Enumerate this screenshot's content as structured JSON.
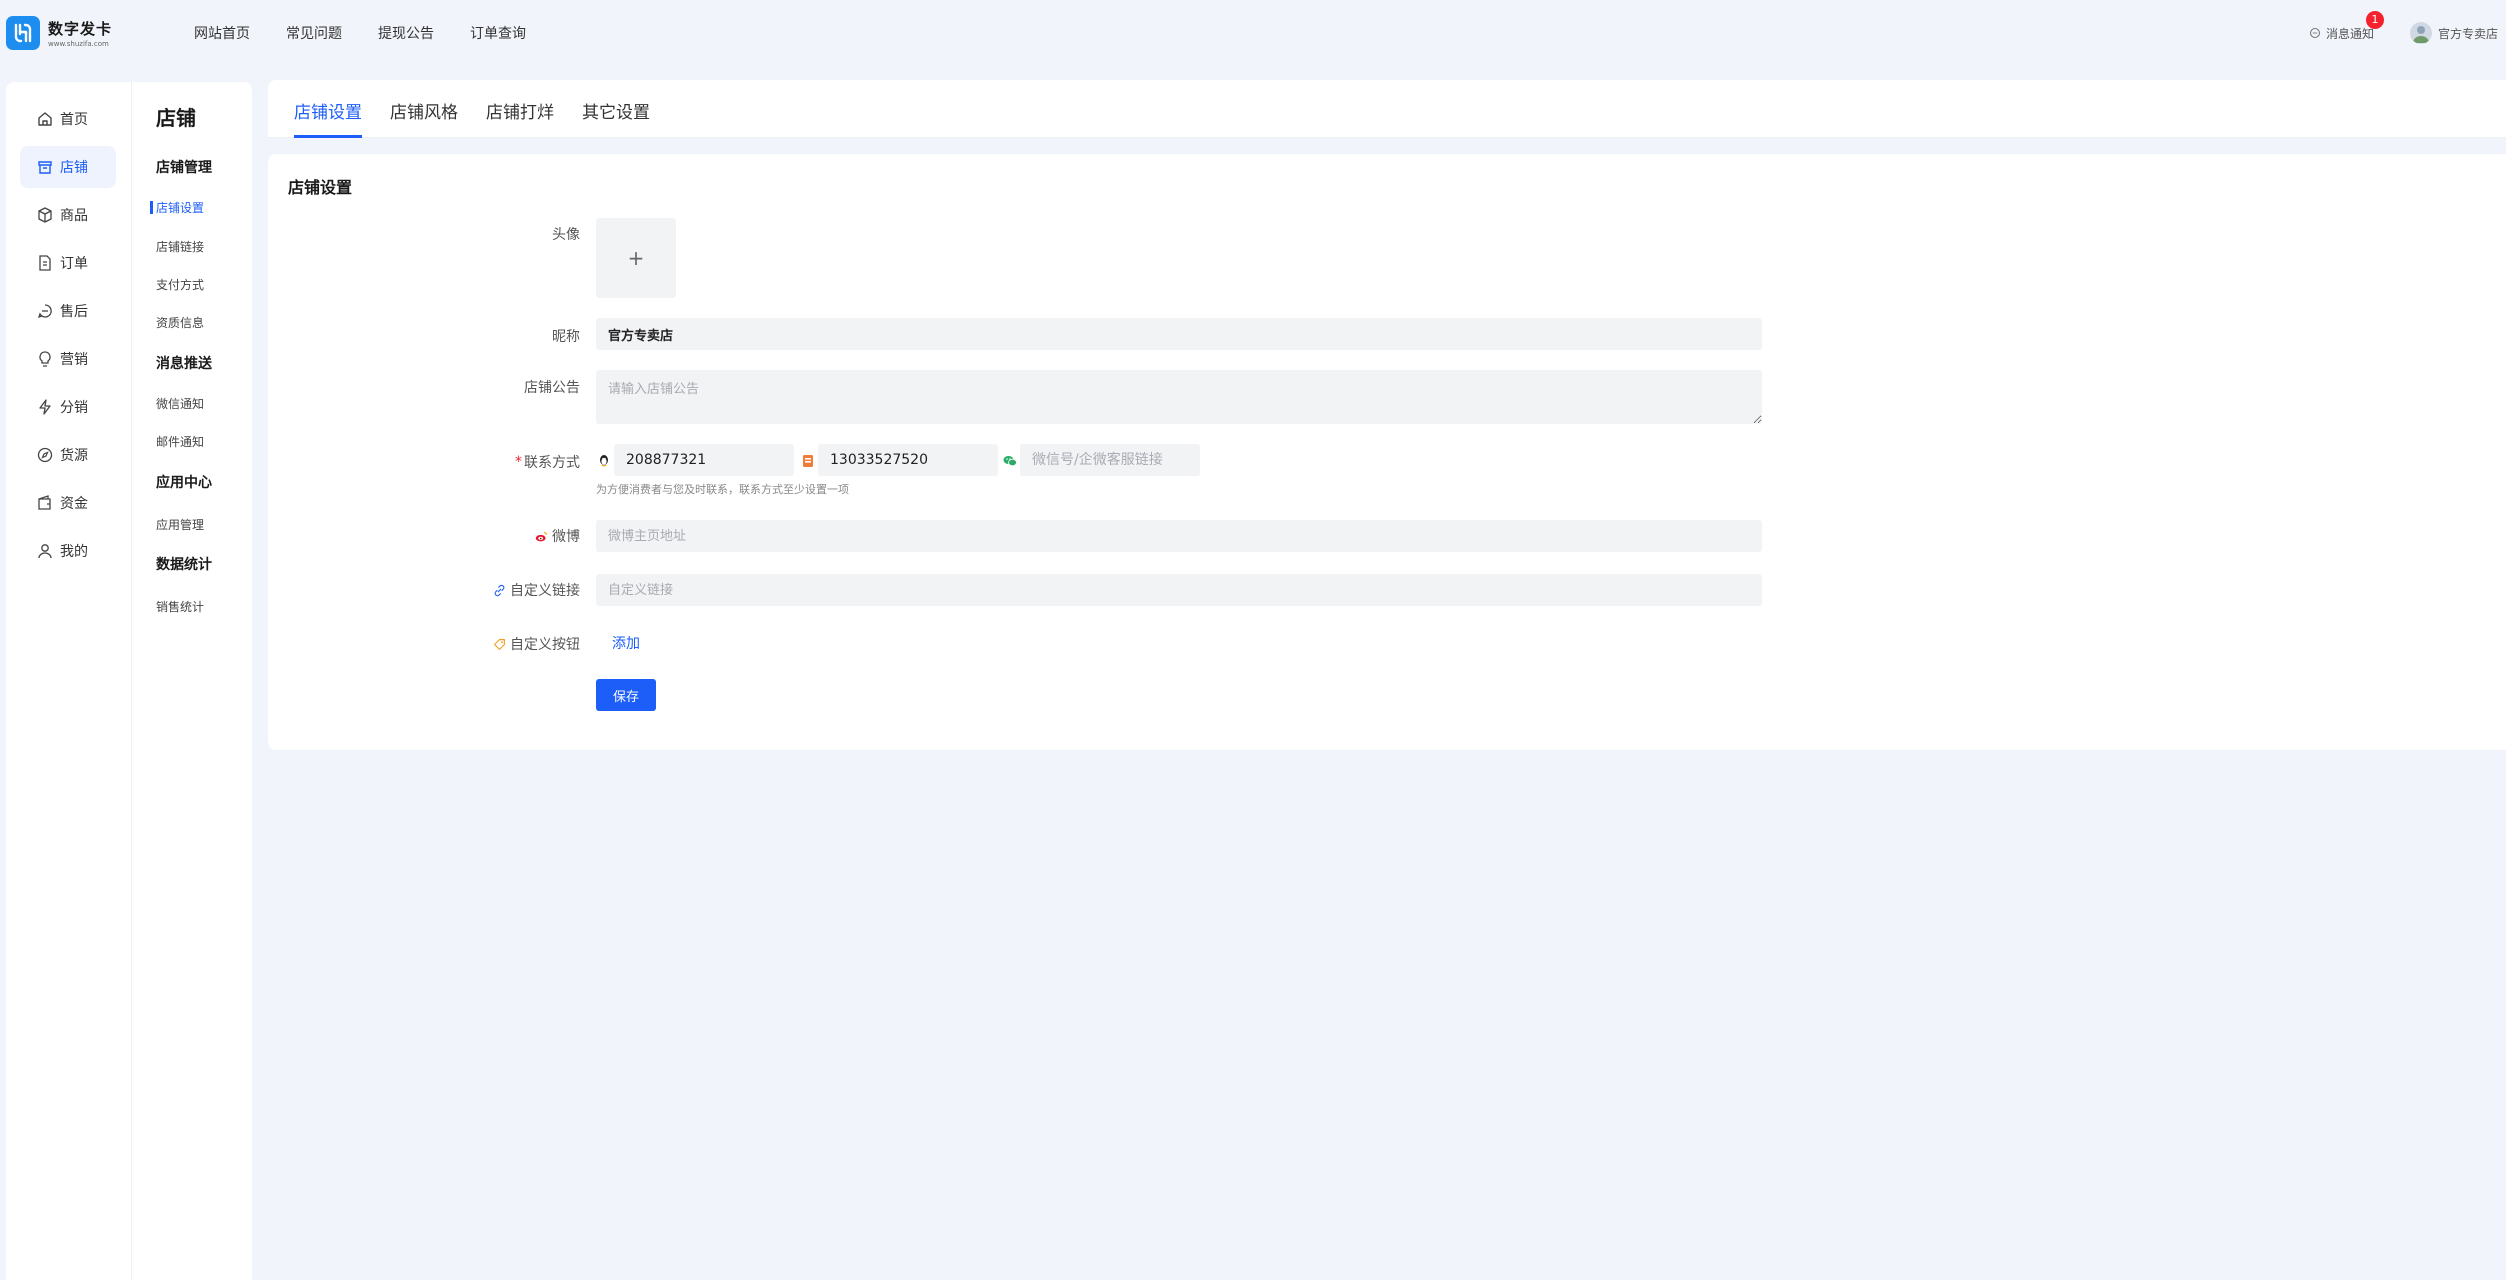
{
  "brand": {
    "title": "数字发卡",
    "subtitle": "www.shuzifa.com",
    "color": "#1e8df0"
  },
  "topnav": [
    {
      "label": "网站首页"
    },
    {
      "label": "常见问题"
    },
    {
      "label": "提现公告"
    },
    {
      "label": "订单查询"
    }
  ],
  "header": {
    "messages_label": "消息通知",
    "messages_count": "1",
    "user_name": "官方专卖店"
  },
  "sidebar": {
    "items": [
      {
        "label": "首页",
        "icon": "home-icon"
      },
      {
        "label": "店铺",
        "icon": "store-icon",
        "active": true
      },
      {
        "label": "商品",
        "icon": "box-icon"
      },
      {
        "label": "订单",
        "icon": "document-icon"
      },
      {
        "label": "售后",
        "icon": "chat-icon"
      },
      {
        "label": "营销",
        "icon": "bulb-icon"
      },
      {
        "label": "分销",
        "icon": "lightning-icon"
      },
      {
        "label": "货源",
        "icon": "compass-icon"
      },
      {
        "label": "资金",
        "icon": "wallet-icon"
      },
      {
        "label": "我的",
        "icon": "user-icon"
      }
    ]
  },
  "subnav": {
    "title": "店铺",
    "groups": [
      {
        "label": "店铺管理",
        "items": [
          "店铺设置",
          "店铺链接",
          "支付方式",
          "资质信息"
        ]
      },
      {
        "label": "消息推送",
        "items": [
          "微信通知",
          "邮件通知"
        ]
      },
      {
        "label": "应用中心",
        "items": [
          "应用管理"
        ]
      },
      {
        "label": "数据统计",
        "items": [
          "销售统计"
        ]
      }
    ]
  },
  "tabs": [
    {
      "label": "店铺设置",
      "active": true
    },
    {
      "label": "店铺风格"
    },
    {
      "label": "店铺打烊"
    },
    {
      "label": "其它设置"
    }
  ],
  "form": {
    "title": "店铺设置",
    "avatar_label": "头像",
    "nickname_label": "昵称",
    "nickname_value": "官方专卖店",
    "notice_label": "店铺公告",
    "notice_placeholder": "请输入店铺公告",
    "contact_label": "联系方式",
    "contact_required": "*",
    "qq_value": "208877321",
    "phone_value": "13033527520",
    "wechat_placeholder": "微信号/企微客服链接",
    "contact_hint": "为方便消费者与您及时联系，联系方式至少设置一项",
    "weibo_label": "微博",
    "weibo_placeholder": "微博主页地址",
    "link_label": "自定义链接",
    "link_placeholder": "自定义链接",
    "button_label": "自定义按钮",
    "add_label": "添加",
    "save_label": "保存"
  },
  "colors": {
    "accent": "#1c5ef7",
    "badge": "#f5222d",
    "background": "#f1f4fb"
  }
}
